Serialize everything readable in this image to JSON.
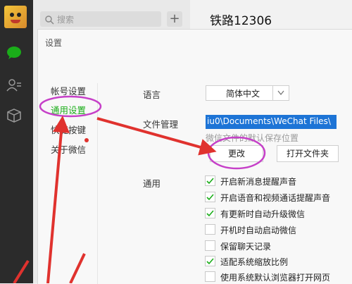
{
  "sidebar": {
    "icons": [
      "avatar",
      "chat-icon",
      "contacts-icon",
      "box-icon"
    ]
  },
  "session": {
    "search_placeholder": "搜索",
    "plus_label": "+"
  },
  "chat": {
    "title": "铁路12306"
  },
  "settings": {
    "window_title": "设置",
    "nav": [
      {
        "label": "帐号设置"
      },
      {
        "label": "通用设置"
      },
      {
        "label": "快捷按键"
      },
      {
        "label": "关于微信"
      }
    ],
    "language_label": "语言",
    "language_value": "简体中文",
    "file_label": "文件管理",
    "file_path": "iu0\\Documents\\WeChat Files\\",
    "file_hint": "微信文件的默认保存位置",
    "change_button": "更改",
    "open_folder_button": "打开文件夹",
    "general_label": "通用",
    "options": [
      {
        "label": "开启新消息提醒声音",
        "checked": true
      },
      {
        "label": "开启语音和视频通话提醒声音",
        "checked": true
      },
      {
        "label": "有更新时自动升级微信",
        "checked": true
      },
      {
        "label": "开机时自动启动微信",
        "checked": false
      },
      {
        "label": "保留聊天记录",
        "checked": false
      },
      {
        "label": "适配系统缩放比例",
        "checked": true
      },
      {
        "label": "使用系统默认浏览器打开网页",
        "checked": false
      }
    ]
  },
  "colors": {
    "accent_green": "#1aad19",
    "annotation_red": "#e0322e",
    "annotation_purple": "#c640c8",
    "selection_blue": "#1d74d6"
  }
}
